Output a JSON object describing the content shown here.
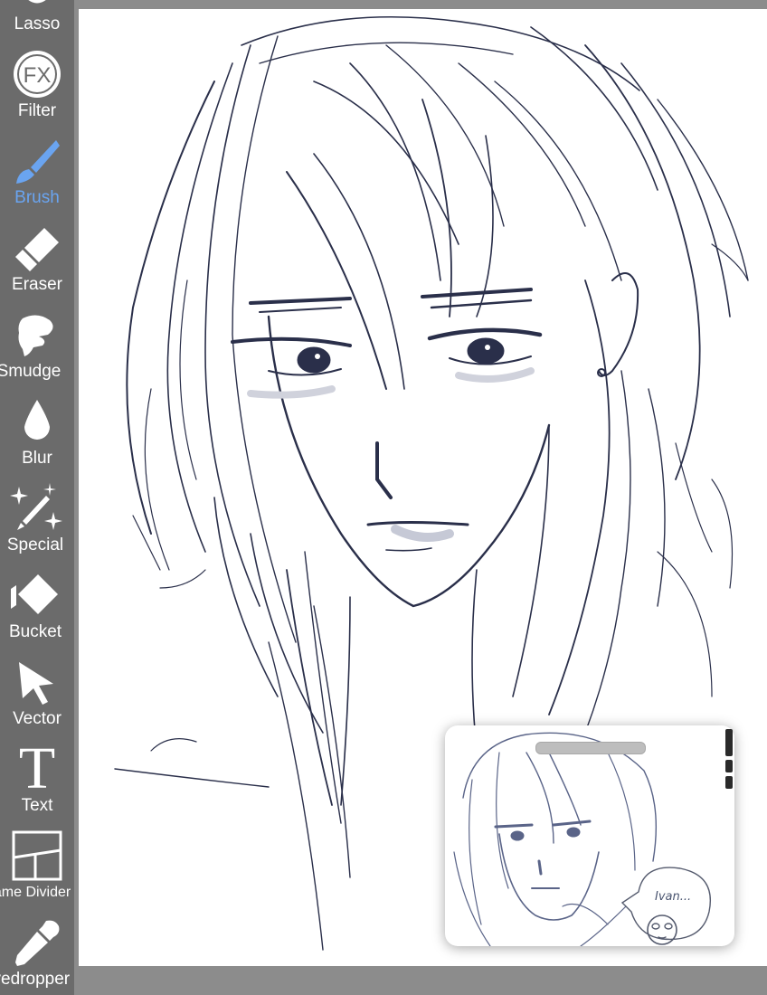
{
  "toolbar": {
    "tools": [
      {
        "label": "Lasso",
        "icon": "lasso-icon",
        "active": false
      },
      {
        "label": "Filter",
        "icon": "fx-icon",
        "active": false
      },
      {
        "label": "Brush",
        "icon": "brush-icon",
        "active": true
      },
      {
        "label": "Eraser",
        "icon": "eraser-icon",
        "active": false
      },
      {
        "label": "Smudge",
        "icon": "smudge-icon",
        "active": false
      },
      {
        "label": "Blur",
        "icon": "blur-icon",
        "active": false
      },
      {
        "label": "Special",
        "icon": "special-icon",
        "active": false
      },
      {
        "label": "Bucket",
        "icon": "bucket-icon",
        "active": false
      },
      {
        "label": "Vector",
        "icon": "vector-icon",
        "active": false
      },
      {
        "label": "Text",
        "icon": "text-icon",
        "active": false
      },
      {
        "label": "Frame Divider",
        "icon": "frame-divider-icon",
        "active": false
      },
      {
        "label": "Eyedropper",
        "icon": "eyedropper-icon",
        "active": false
      }
    ],
    "fx_glyph": "FX",
    "text_glyph": "T"
  },
  "reference": {
    "bubble_text": "Ivan..."
  },
  "colors": {
    "toolbar_bg": "#6b6b6b",
    "active_accent": "#6aa4f0",
    "sketch_ink": "#2a2f4a",
    "workspace_bg": "#8c8c8c"
  }
}
